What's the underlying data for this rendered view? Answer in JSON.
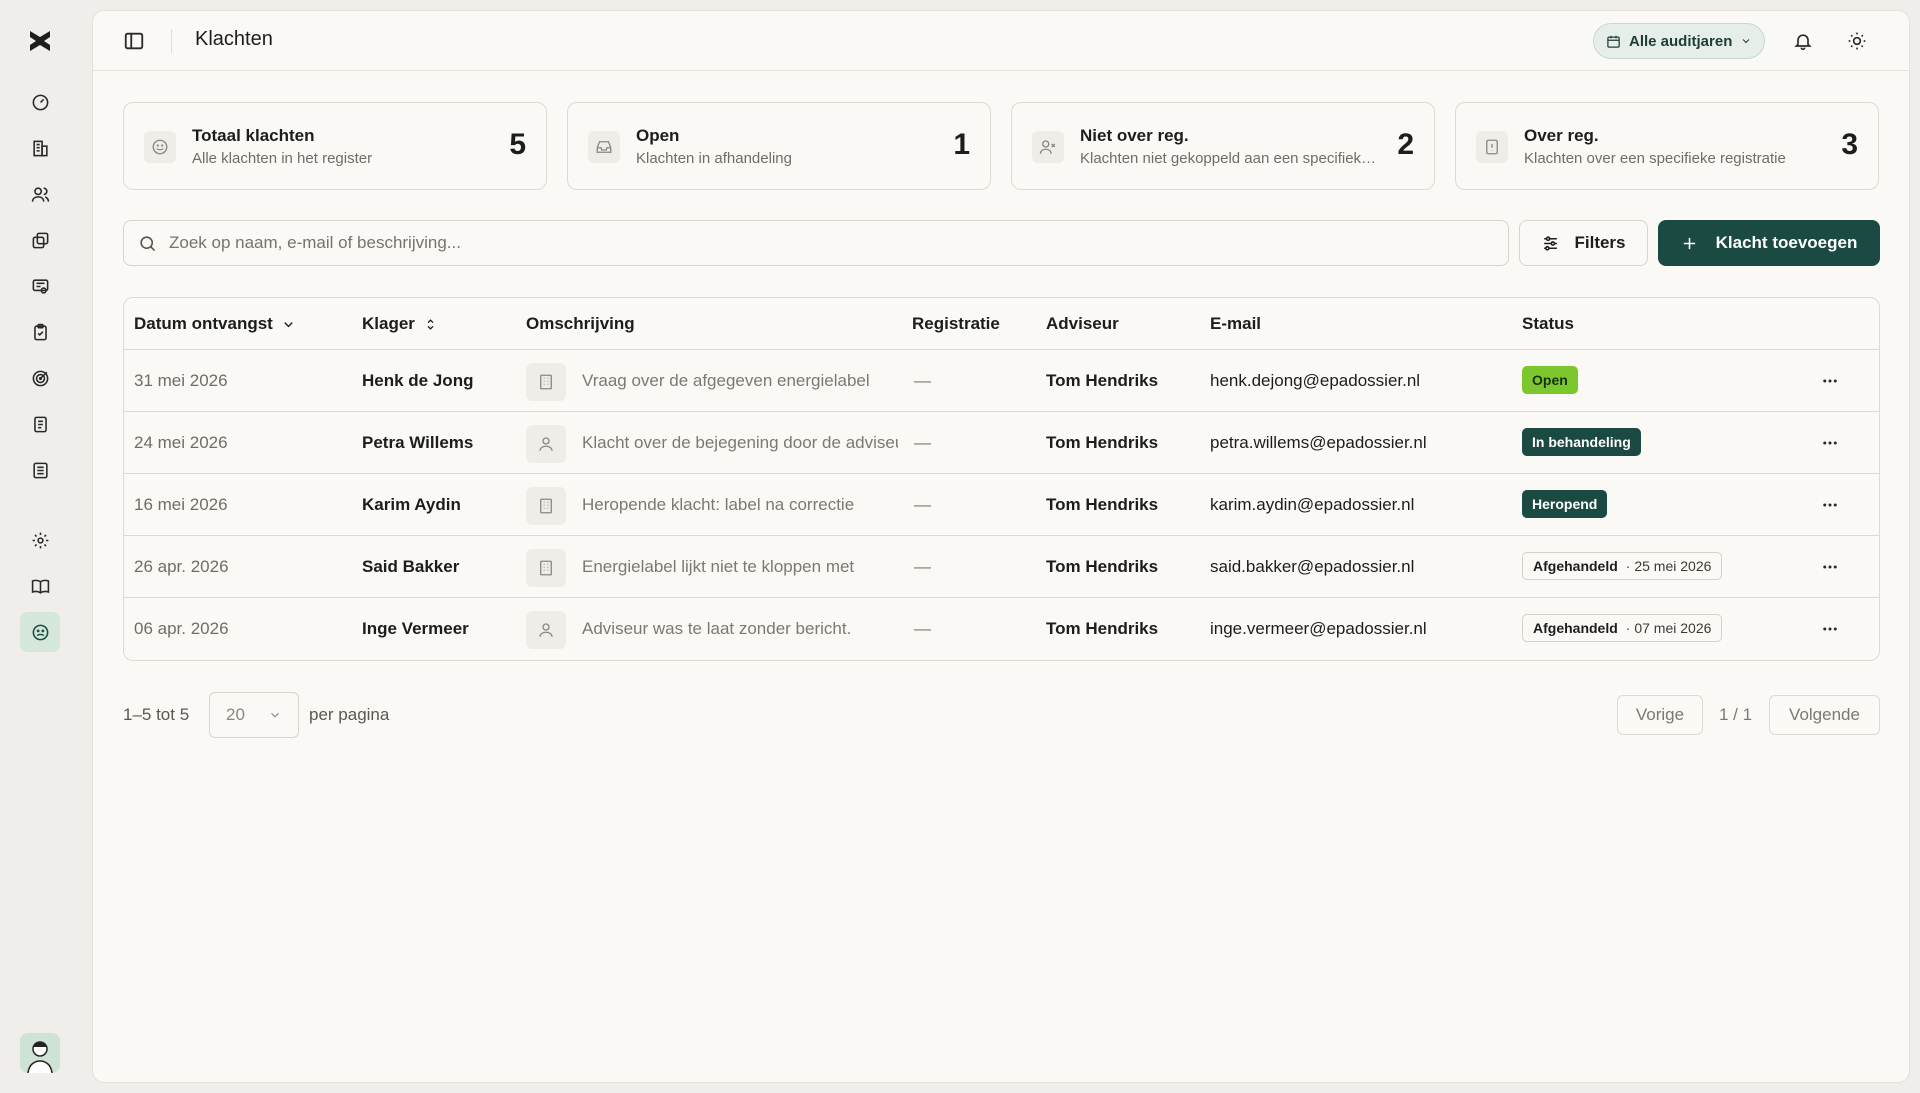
{
  "app": {
    "page_title": "Klachten"
  },
  "topbar": {
    "year_filter": "Alle auditjaren"
  },
  "stats": [
    {
      "title": "Totaal klachten",
      "subtitle": "Alle klachten in het register",
      "value": "5",
      "icon": "smile-icon"
    },
    {
      "title": "Open",
      "subtitle": "Klachten in afhandeling",
      "value": "1",
      "icon": "inbox-icon"
    },
    {
      "title": "Niet over reg.",
      "subtitle": "Klachten niet gekoppeld aan een specifieke registratie",
      "value": "2",
      "icon": "user-x-icon"
    },
    {
      "title": "Over reg.",
      "subtitle": "Klachten over een specifieke registratie",
      "value": "3",
      "icon": "file-alert-icon"
    }
  ],
  "search": {
    "placeholder": "Zoek op naam, e-mail of beschrijving..."
  },
  "toolbar": {
    "filters_label": "Filters",
    "add_label": "Klacht toevoegen"
  },
  "table": {
    "headers": {
      "date": "Datum ontvangst",
      "complainant": "Klager",
      "description": "Omschrijving",
      "registration": "Registratie",
      "advisor": "Adviseur",
      "email": "E-mail",
      "status": "Status"
    },
    "rows": [
      {
        "date": "31 mei 2026",
        "name": "Henk de Jong",
        "desc_icon": "building-icon",
        "description": "Vraag over de afgegeven energielabel",
        "registration": "—",
        "advisor": "Tom Hendriks",
        "email": "henk.dejong@epadossier.nl",
        "status": "Open",
        "status_kind": "open",
        "status_date": ""
      },
      {
        "date": "24 mei 2026",
        "name": "Petra Willems",
        "desc_icon": "user-icon",
        "description": "Klacht over de bejegening door de adviseur",
        "registration": "—",
        "advisor": "Tom Hendriks",
        "email": "petra.willems@epadossier.nl",
        "status": "In behandeling",
        "status_kind": "dark",
        "status_date": ""
      },
      {
        "date": "16 mei 2026",
        "name": "Karim Aydin",
        "desc_icon": "building-icon",
        "description": "Heropende klacht: label na correctie",
        "registration": "—",
        "advisor": "Tom Hendriks",
        "email": "karim.aydin@epadossier.nl",
        "status": "Heropend",
        "status_kind": "dark",
        "status_date": ""
      },
      {
        "date": "26 apr. 2026",
        "name": "Said Bakker",
        "desc_icon": "building-icon",
        "description": "Energielabel lijkt niet te kloppen met",
        "registration": "—",
        "advisor": "Tom Hendriks",
        "email": "said.bakker@epadossier.nl",
        "status": "Afgehandeld",
        "status_kind": "outline",
        "status_date": "· 25 mei 2026"
      },
      {
        "date": "06 apr. 2026",
        "name": "Inge Vermeer",
        "desc_icon": "user-icon",
        "description": "Adviseur was te laat zonder bericht.",
        "registration": "—",
        "advisor": "Tom Hendriks",
        "email": "inge.vermeer@epadossier.nl",
        "status": "Afgehandeld",
        "status_kind": "outline",
        "status_date": "· 07 mei 2026"
      }
    ]
  },
  "pagination": {
    "range": "1–5 tot 5",
    "page_size": "20",
    "per_page_label": "per pagina",
    "prev": "Vorige",
    "page_info": "1 / 1",
    "next": "Volgende"
  },
  "colors": {
    "accent": "#1b4a42",
    "open_badge": "#7cc72e",
    "background": "#efeeea",
    "card": "#faf9f6"
  }
}
